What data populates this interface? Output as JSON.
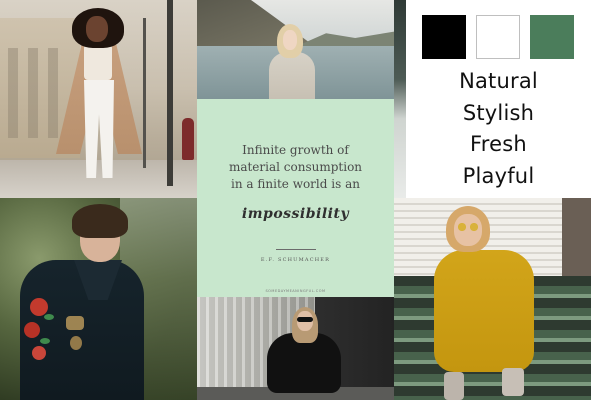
{
  "palette": {
    "swatches": [
      {
        "name": "black",
        "color": "#000000"
      },
      {
        "name": "white",
        "color": "#ffffff"
      },
      {
        "name": "green",
        "color": "#4b7d5b"
      }
    ],
    "words": [
      "Natural",
      "Stylish",
      "Fresh",
      "Playful"
    ]
  },
  "quote": {
    "lines": [
      "Infinite growth of",
      "material consumption",
      "in a finite world is an"
    ],
    "emphasis": "impossibility",
    "author": "E.F. SCHUMACHER",
    "site": "SOMEDAYMEANINGFUL.COM"
  },
  "colors": {
    "quote_bg": "#c8e7cd",
    "accent_green": "#4b7d5b",
    "mustard": "#d2a51a",
    "camel": "#c79f7d"
  }
}
